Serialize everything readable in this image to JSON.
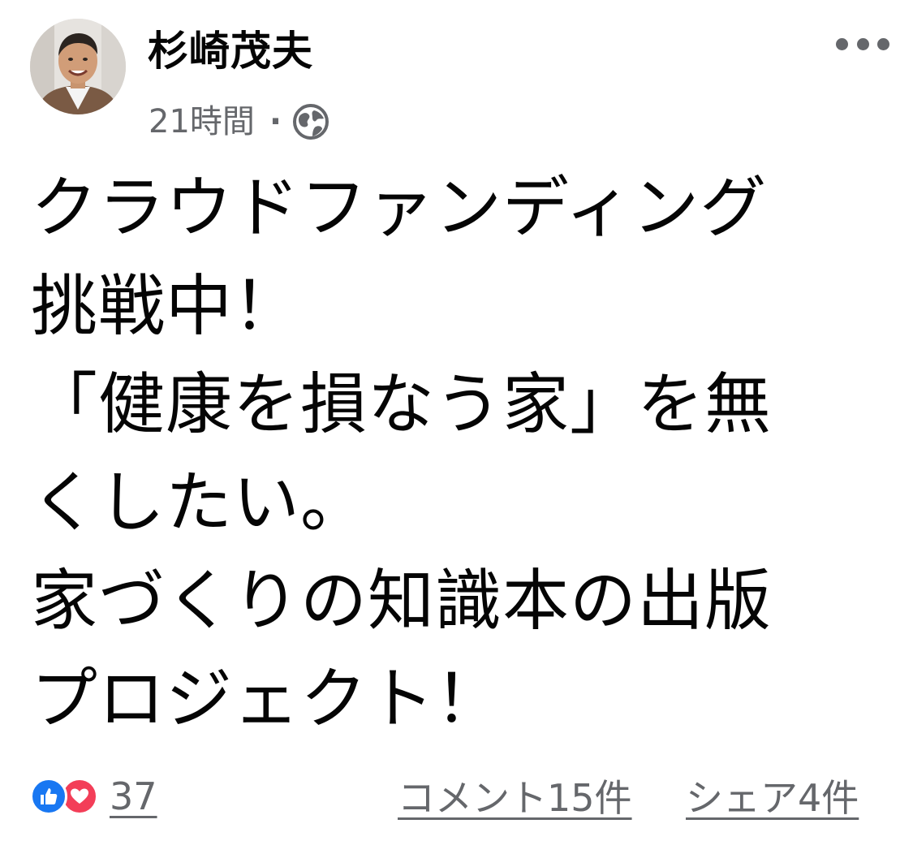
{
  "post": {
    "author": "杉崎茂夫",
    "time": "21時間",
    "separator": "·",
    "privacy_icon": "globe-icon",
    "more_icon": "more-options-icon",
    "body_lines": [
      "クラウドファンディング",
      "挑戦中！",
      "「健康を損なう家」を無",
      "くしたい。",
      "家づくりの知識本の出版",
      "プロジェクト！"
    ]
  },
  "footer": {
    "reaction_icons": [
      "like-icon",
      "love-icon"
    ],
    "reaction_count": "37",
    "comments": "コメント15件",
    "shares": "シェア4件"
  },
  "colors": {
    "text": "#050505",
    "secondary": "#65676b",
    "like": "#1877f2",
    "love": "#f33e58"
  }
}
